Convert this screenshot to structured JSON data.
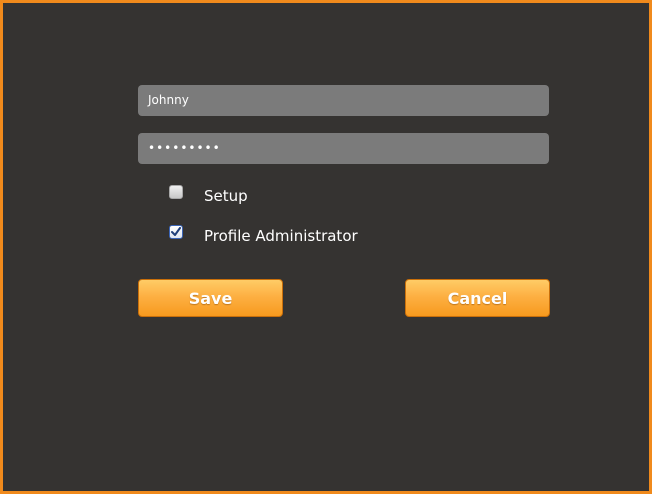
{
  "form": {
    "username_value": "Johnny",
    "password_masked": "•••••••••",
    "options": [
      {
        "label": "Setup",
        "checked": false
      },
      {
        "label": "Profile Administrator",
        "checked": true
      }
    ],
    "save_label": "Save",
    "cancel_label": "Cancel"
  },
  "colors": {
    "frame_border": "#f08a1c",
    "background": "#353331",
    "field_background": "#7b7b7b",
    "button_orange": "#fdb043"
  }
}
